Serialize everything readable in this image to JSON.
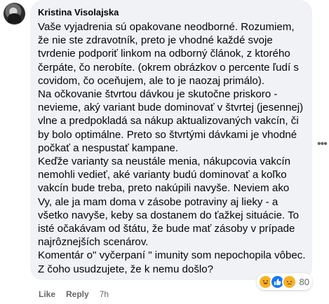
{
  "comment": {
    "author": "Kristina Visolajska",
    "lines": [
      "Vaše vyjadrenia sú opakovane neodborné. Rozumiem,",
      "že nie ste zdravotník, preto je vhodné každé svoje",
      "tvrdenie podporiť linkom na odborný článok, z ktorého",
      "čerpáte, čo nerobíte. (okrem obrázkov o percente ľudí s",
      "covidom, čo oceňujem, ale to je naozaj primálo).",
      "Na očkovanie štvrtou dávkou je skutočne priskoro -",
      "nevieme, aký variant bude dominovať v štvrtej (jesennej)",
      "vlne a predpokladá sa nákup aktualizovaných vakcín, či",
      "by bolo optimálne. Preto so štvrtými dávkami je vhodné",
      "počkať a nespustať kampane.",
      "Keďže varianty sa neustále menia, nákupcovia vakcín",
      "nemohli vedieť, aké varianty budú dominovať a koľko",
      "vakcín bude treba, preto nakúpili navyše. Neviem ako",
      "Vy, ale ja mam doma v zásobe potraviny aj lieky - a",
      "všetko navyše, keby sa dostanem do ťažkej situácie. To",
      "isté očakávam od štátu, že bude mať zásoby v prípade",
      "najrôznejších scenárov.",
      "Komentár o\" vyčerpaní \" imunity som nepochopila vôbec.",
      "Z čoho usudzujete, že k nemu došlo?"
    ],
    "reactions": {
      "icons": [
        "haha-icon",
        "like-icon",
        "sad-icon"
      ],
      "count": "80"
    },
    "actions": {
      "like": "Like",
      "reply": "Reply",
      "time": "7h"
    },
    "more_icon": "more-horizontal-icon"
  }
}
